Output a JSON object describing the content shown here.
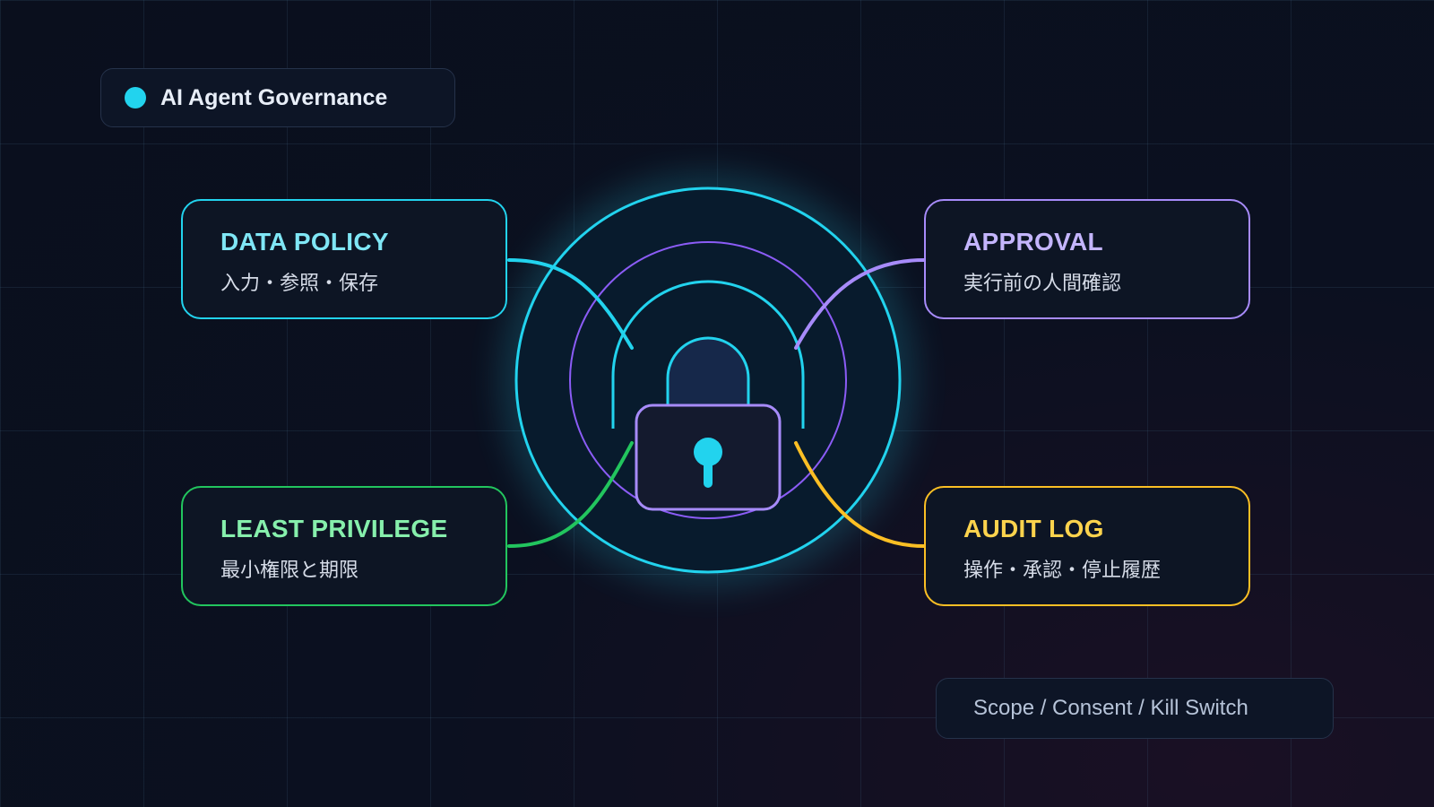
{
  "header": {
    "badge_label": "AI Agent Governance"
  },
  "cards": [
    {
      "title": "DATA POLICY",
      "subtitle": "入力・参照・保存"
    },
    {
      "title": "APPROVAL",
      "subtitle": "実行前の人間確認"
    },
    {
      "title": "LEAST PRIVILEGE",
      "subtitle": "最小権限と期限"
    },
    {
      "title": "AUDIT LOG",
      "subtitle": "操作・承認・停止履歴"
    }
  ],
  "footer": {
    "label": "Scope / Consent / Kill Switch"
  },
  "center": {
    "icon": "padlock-icon"
  },
  "colors": {
    "cyan": "#22d3ee",
    "purple": "#a78bfa",
    "green": "#22c55e",
    "amber": "#fbbf24"
  }
}
